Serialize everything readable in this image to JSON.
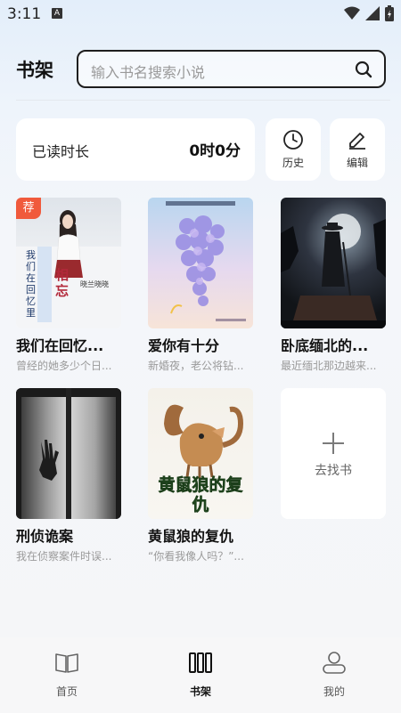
{
  "status_bar": {
    "time": "3:11",
    "notif_letter": "A"
  },
  "header": {
    "title": "书架",
    "search_placeholder": "输入书名搜索小说"
  },
  "reading": {
    "label": "已读时长",
    "value": "0时0分"
  },
  "actions": {
    "history": "历史",
    "edit": "编辑"
  },
  "books": [
    {
      "title": "我们在回忆里",
      "display_title": "我们在回忆...",
      "desc": "曾经的她多少个日...",
      "badge": "荐",
      "cover_text_a": "我们在回忆里",
      "cover_text_b": "相忘",
      "cover_author": "晓兰晓晓"
    },
    {
      "title": "爱你有十分",
      "display_title": "爱你有十分",
      "desc": "新婚夜，老公将钻..."
    },
    {
      "title": "卧底缅北的...",
      "display_title": "卧底缅北的...",
      "desc": "最近缅北那边越来..."
    },
    {
      "title": "刑侦诡案",
      "display_title": "刑侦诡案",
      "desc": "我在侦察案件时误..."
    },
    {
      "title": "黄鼠狼的复仇",
      "display_title": "黄鼠狼的复仇",
      "desc": "“你看我像人吗？”...",
      "cover_text": "黄鼠狼的复仇"
    }
  ],
  "add_book": {
    "label": "去找书"
  },
  "nav": {
    "home": "首页",
    "shelf": "书架",
    "mine": "我的"
  },
  "colors": {
    "badge": "#f05a3c",
    "background": "#f5f6f8",
    "card": "#ffffff"
  }
}
